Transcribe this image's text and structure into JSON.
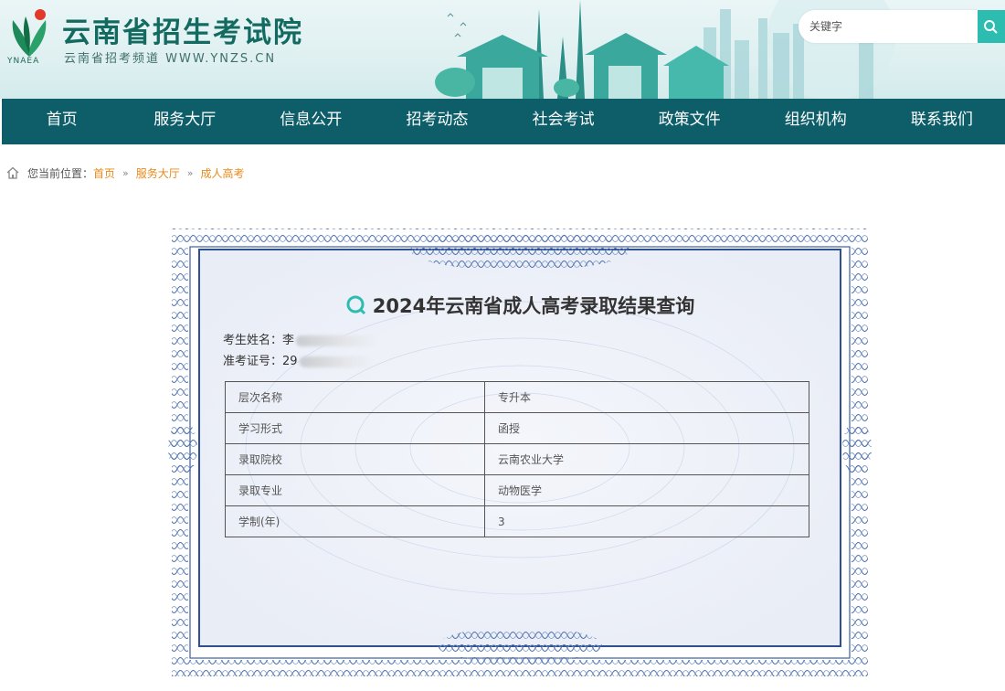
{
  "header": {
    "site_title": "云南省招生考试院",
    "site_subtitle": "云南省招考频道 WWW.YNZS.CN",
    "logo_abbr": "YNAEA",
    "search_placeholder": "关键字",
    "logo_icon": "ynaea-logo-icon",
    "search_icon": "search-icon"
  },
  "nav": {
    "items": [
      "首页",
      "服务大厅",
      "信息公开",
      "招考动态",
      "社会考试",
      "政策文件",
      "组织机构",
      "联系我们"
    ]
  },
  "breadcrumb": {
    "prefix": "您当前位置：",
    "items": [
      "首页",
      "服务大厅",
      "成人高考"
    ],
    "separator": "»",
    "home_icon": "home-icon"
  },
  "result": {
    "title": "2024年云南省成人高考录取结果查询",
    "name_label": "考生姓名：",
    "name_value": "李",
    "id_label": "准考证号：",
    "id_value": "29",
    "rows": [
      {
        "key": "层次名称",
        "value": "专升本"
      },
      {
        "key": "学习形式",
        "value": "函授"
      },
      {
        "key": "录取院校",
        "value": "云南农业大学"
      },
      {
        "key": "录取专业",
        "value": "动物医学"
      },
      {
        "key": "学制(年)",
        "value": "3"
      }
    ],
    "title_icon": "query-icon"
  },
  "colors": {
    "nav_bg": "#0e5e6a",
    "brand": "#126a60",
    "accent": "#2dbdb0",
    "crumb": "#e88a1a",
    "border_blue": "#3d5fa3"
  }
}
